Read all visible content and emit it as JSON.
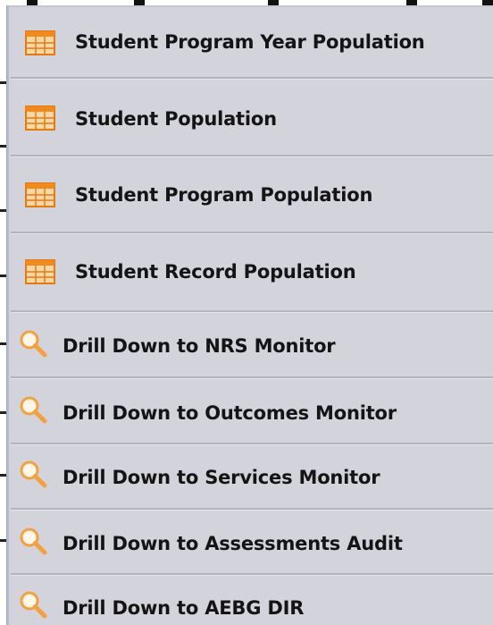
{
  "menu": {
    "items": [
      {
        "label": "Student Program Year Population",
        "icon": "table-icon"
      },
      {
        "label": "Student Population",
        "icon": "table-icon"
      },
      {
        "label": "Student Program Population",
        "icon": "table-icon"
      },
      {
        "label": "Student Record Population",
        "icon": "table-icon"
      },
      {
        "label": "Drill Down to NRS Monitor",
        "icon": "search-icon"
      },
      {
        "label": "Drill Down to Outcomes Monitor",
        "icon": "search-icon"
      },
      {
        "label": "Drill Down to Services Monitor",
        "icon": "search-icon"
      },
      {
        "label": "Drill Down to Assessments Audit",
        "icon": "search-icon"
      },
      {
        "label": "Drill Down to AEBG DIR",
        "icon": "search-icon"
      }
    ]
  },
  "colors": {
    "menu_background": "#d3d3dc",
    "table_icon_orange": "#f08a1e",
    "search_icon_orange": "#f2a040"
  }
}
